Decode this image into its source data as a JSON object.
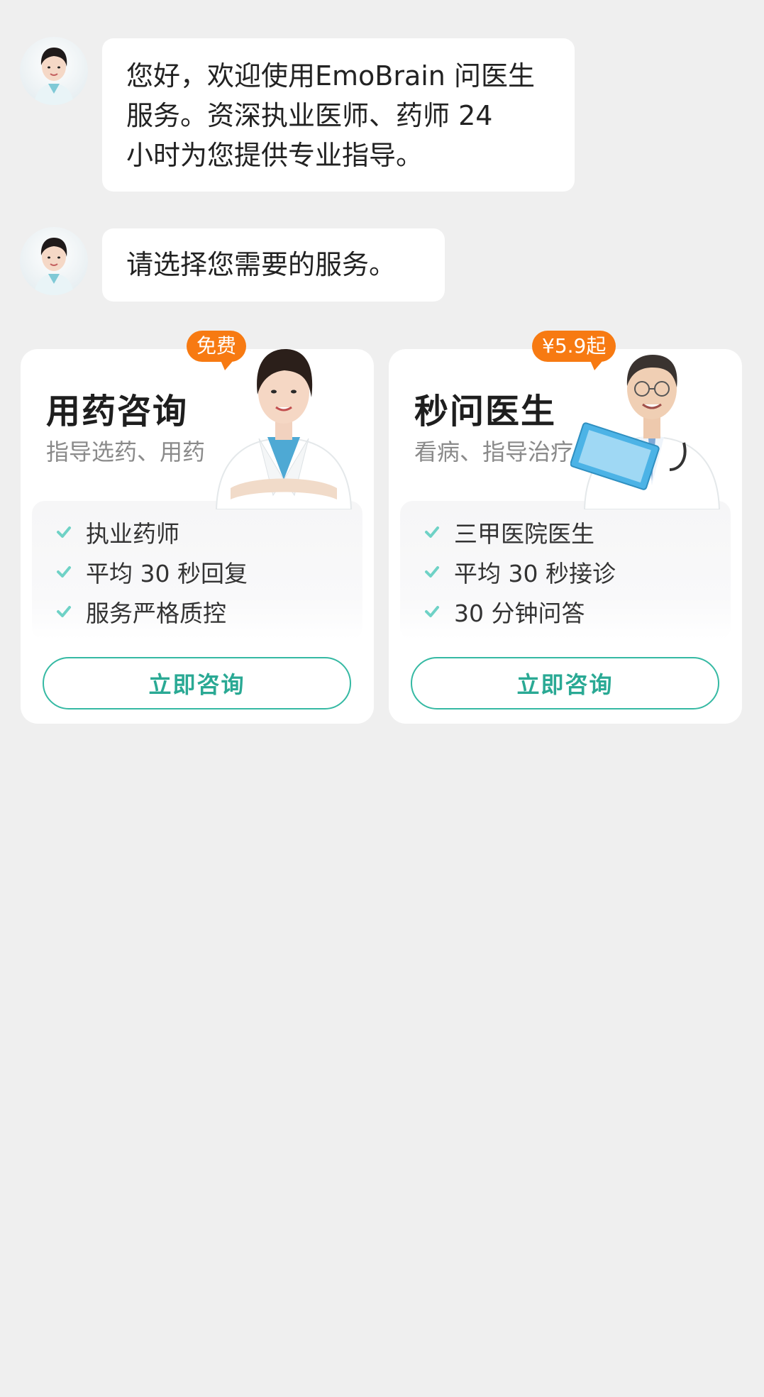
{
  "messages": [
    {
      "lines": [
        "您好，欢迎使用EmoBrain 问医生",
        "服务。资深执业医师、药师 24",
        "小时为您提供专业指导。"
      ]
    },
    {
      "lines": [
        "请选择您需要的服务。"
      ]
    }
  ],
  "cards": [
    {
      "badge": "免费",
      "title": "用药咨询",
      "subtitle": "指导选药、用药",
      "features": [
        "执业药师",
        "平均 30 秒回复",
        "服务严格质控"
      ],
      "button": "立即咨询",
      "figure_icon": "female-pharmacist-illustration"
    },
    {
      "badge": "¥5.9起",
      "title": "秒问医生",
      "subtitle": "看病、指导治疗",
      "features": [
        "三甲医院医生",
        "平均 30 秒接诊",
        "30 分钟问答"
      ],
      "button": "立即咨询",
      "figure_icon": "male-doctor-illustration"
    }
  ],
  "colors": {
    "background": "#efefef",
    "accent": "#35b9a3",
    "badge": "#f77a12",
    "check": "#6fd2c6"
  }
}
